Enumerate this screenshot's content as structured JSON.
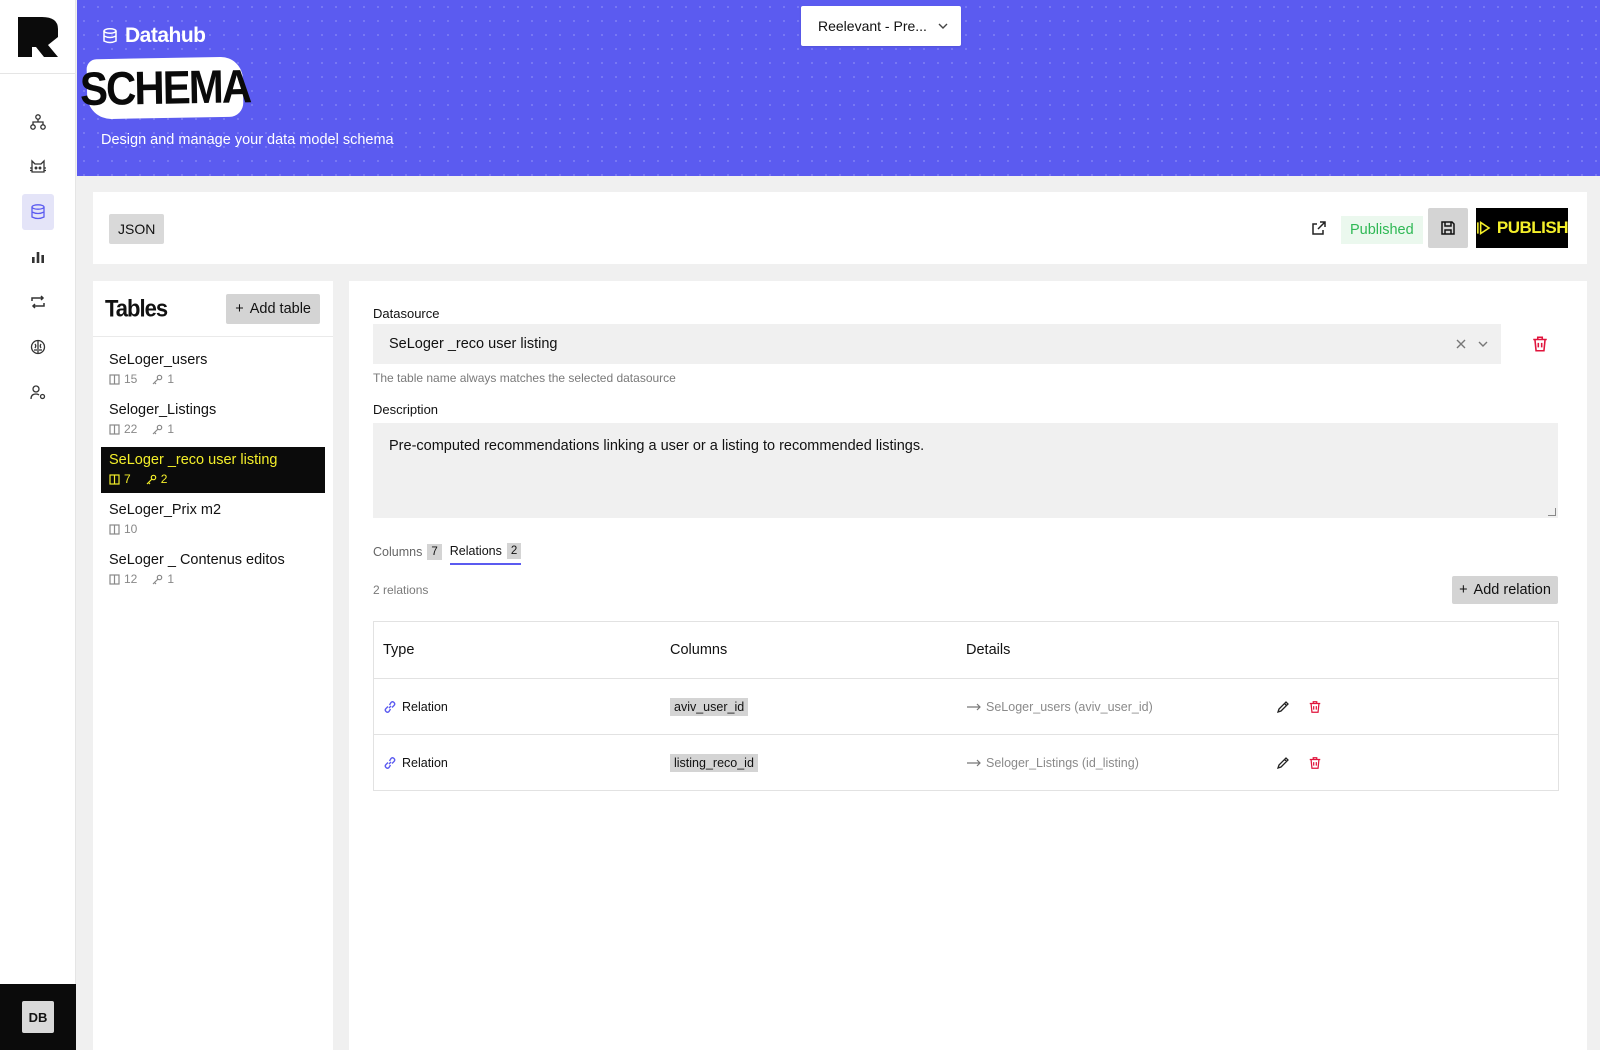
{
  "app": {
    "brand_label": "Datahub",
    "page_badge": "SCHEMA",
    "subtitle": "Design and manage your data model schema",
    "project_select": "Reelevant - Pre...",
    "user_initials": "DB"
  },
  "nav": [
    {
      "name": "nav-hierarchy-icon",
      "active": false
    },
    {
      "name": "nav-cat-icon",
      "active": false
    },
    {
      "name": "nav-database-icon",
      "active": true
    },
    {
      "name": "nav-bar-chart-icon",
      "active": false
    },
    {
      "name": "nav-repeat-icon",
      "active": false
    },
    {
      "name": "nav-brain-icon",
      "active": false
    },
    {
      "name": "nav-user-settings-icon",
      "active": false
    }
  ],
  "toolbar": {
    "json_label": "JSON",
    "status_label": "Published",
    "publish_label": "PUBLISH"
  },
  "tables": {
    "title": "Tables",
    "add_label": "Add table",
    "items": [
      {
        "name": "SeLoger_users",
        "columns": "15",
        "keys": "1",
        "selected": false
      },
      {
        "name": "Seloger_Listings",
        "columns": "22",
        "keys": "1",
        "selected": false
      },
      {
        "name": "SeLoger _reco user listing",
        "columns": "7",
        "keys": "2",
        "selected": true
      },
      {
        "name": "SeLoger_Prix m2",
        "columns": "10",
        "keys": "",
        "selected": false
      },
      {
        "name": "SeLoger _ Contenus editos",
        "columns": "12",
        "keys": "1",
        "selected": false
      }
    ]
  },
  "detail": {
    "datasource_label": "Datasource",
    "datasource_value": "SeLoger _reco user listing",
    "datasource_help": "The table name always matches the selected datasource",
    "description_label": "Description",
    "description_value": "Pre-computed recommendations linking a user or a listing to recommended listings.",
    "tabs": [
      {
        "label": "Columns",
        "count": "7",
        "active": false
      },
      {
        "label": "Relations",
        "count": "2",
        "active": true
      }
    ],
    "relations_count": "2 relations",
    "add_relation_label": "Add relation",
    "table_headers": {
      "type": "Type",
      "columns": "Columns",
      "details": "Details"
    },
    "relations": [
      {
        "type": "Relation",
        "column": "aviv_user_id",
        "details": "SeLoger_users (aviv_user_id)"
      },
      {
        "type": "Relation",
        "column": "listing_reco_id",
        "details": "Seloger_Listings (id_listing)"
      }
    ]
  },
  "colors": {
    "accent": "#5b5bf0",
    "highlight": "#f4ef2a",
    "success": "#2fb855",
    "danger": "#e0143c"
  }
}
